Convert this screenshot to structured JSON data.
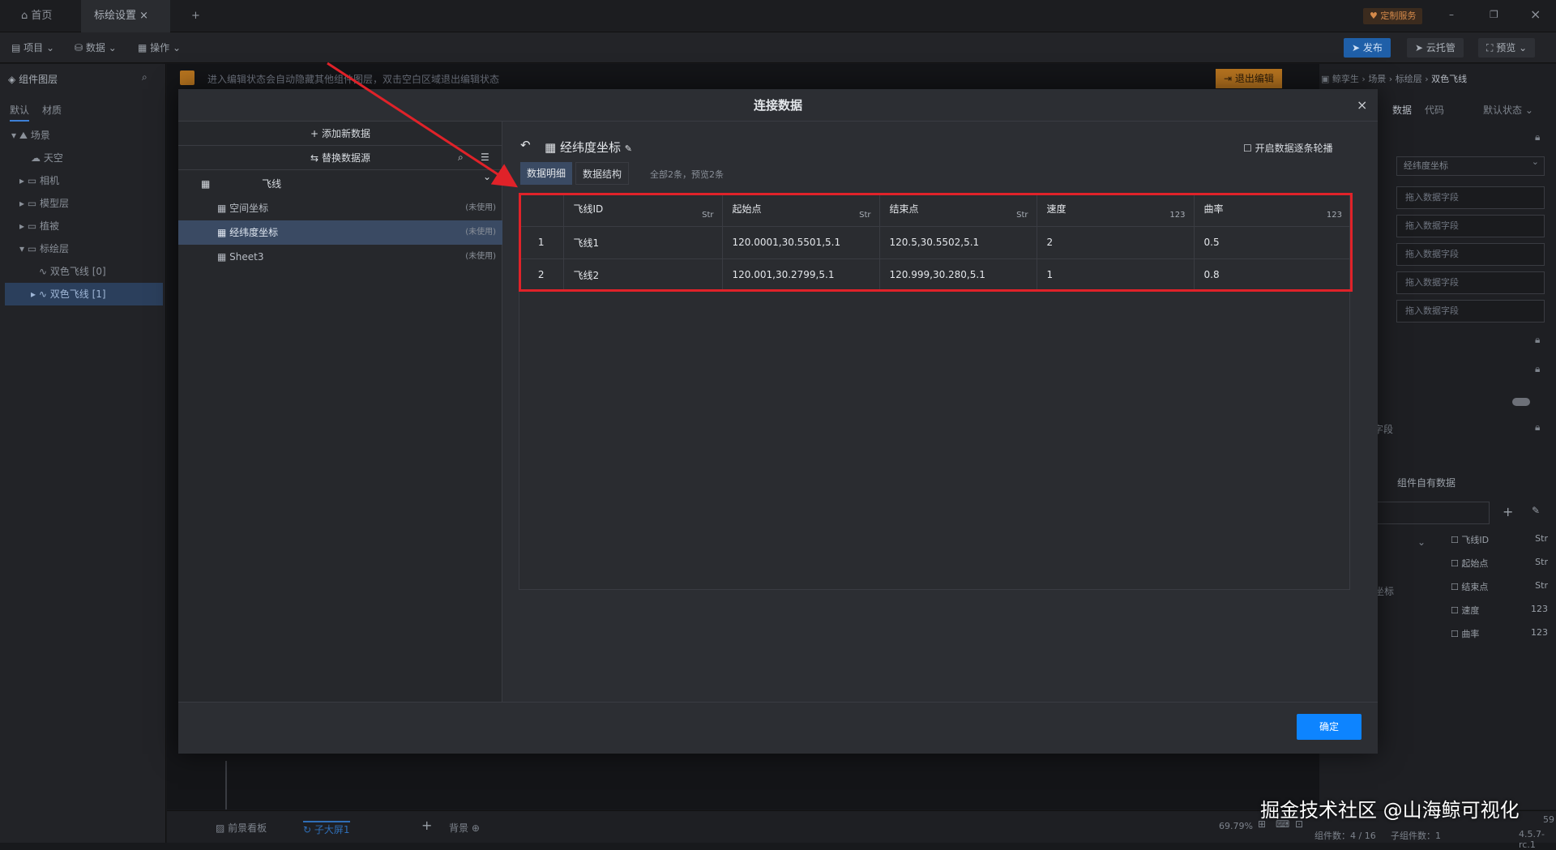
{
  "tabs": [
    {
      "label": "首页"
    },
    {
      "label": "标绘设置"
    }
  ],
  "top_right": {
    "custom_service": "定制服务",
    "publish": "发布",
    "cloud": "云托管",
    "preview": "预览"
  },
  "menubar": {
    "project": "项目",
    "data": "数据",
    "operation": "操作"
  },
  "left_panel": {
    "title": "组件图层",
    "tabs": [
      "默认",
      "材质"
    ],
    "tree": [
      {
        "label": "场景"
      },
      {
        "label": "天空"
      },
      {
        "label": "相机"
      },
      {
        "label": "模型层"
      },
      {
        "label": "植被"
      },
      {
        "label": "标绘层"
      },
      {
        "label": "双色飞线 [0]"
      },
      {
        "label": "双色飞线 [1]"
      }
    ]
  },
  "edit_hint": "进入编辑状态会自动隐藏其他组件图层，双击空白区域退出编辑状态",
  "exit_edit": "退出编辑",
  "right_panel": {
    "breadcrumb": [
      "鲸孪生",
      "场景",
      "标绘层",
      "双色飞线"
    ],
    "tabs": [
      "数据",
      "代码"
    ],
    "state": "默认状态",
    "select": "经纬度坐标",
    "fields": [
      "拖入数据字段",
      "拖入数据字段",
      "拖入数据字段",
      "拖入数据字段",
      "拖入数据字段"
    ],
    "own_data": "组件自有数据",
    "partial_field": "字段",
    "partial_axis": "坐标",
    "columns": [
      {
        "name": "飞线ID",
        "type": "Str"
      },
      {
        "name": "起始点",
        "type": "Str"
      },
      {
        "name": "结束点",
        "type": "Str"
      },
      {
        "name": "速度",
        "type": "123"
      },
      {
        "name": "曲率",
        "type": "123"
      }
    ]
  },
  "modal": {
    "title": "连接数据",
    "add_data": "添加新数据",
    "replace_source": "替换数据源",
    "group": "飞线",
    "sources": [
      {
        "name": "空间坐标",
        "status": "(未使用)"
      },
      {
        "name": "经纬度坐标",
        "status": "(未使用)"
      },
      {
        "name": "Sheet3",
        "status": "(未使用)"
      }
    ],
    "dataset_name": "经纬度坐标",
    "poll_label": "开启数据逐条轮播",
    "subtabs": [
      "数据明细",
      "数据结构"
    ],
    "summary": "全部2条，预览2条",
    "confirm": "确定"
  },
  "table": {
    "headers": [
      {
        "name": "飞线ID",
        "type": "Str"
      },
      {
        "name": "起始点",
        "type": "Str"
      },
      {
        "name": "结束点",
        "type": "Str"
      },
      {
        "name": "速度",
        "type": "123"
      },
      {
        "name": "曲率",
        "type": "123"
      }
    ],
    "rows": [
      {
        "idx": "1",
        "cells": [
          "飞线1",
          "120.0001,30.5501,5.1",
          "120.5,30.5502,5.1",
          "2",
          "0.5"
        ]
      },
      {
        "idx": "2",
        "cells": [
          "飞线2",
          "120.001,30.2799,5.1",
          "120.999,30.280,5.1",
          "1",
          "0.8"
        ]
      }
    ]
  },
  "bottom": {
    "tabs": [
      "前景看板",
      "子大屏1",
      "背景"
    ],
    "zoom": "69.79%",
    "count": "组件数：4 / 16",
    "sub_count": "子组件数：1",
    "version": "4.5.7-rc.1",
    "partial_num": "59"
  },
  "watermark": "掘金技术社区 @山海鲸可视化",
  "colors": {
    "accent": "#0d84ff",
    "highlight": "#e02229"
  }
}
